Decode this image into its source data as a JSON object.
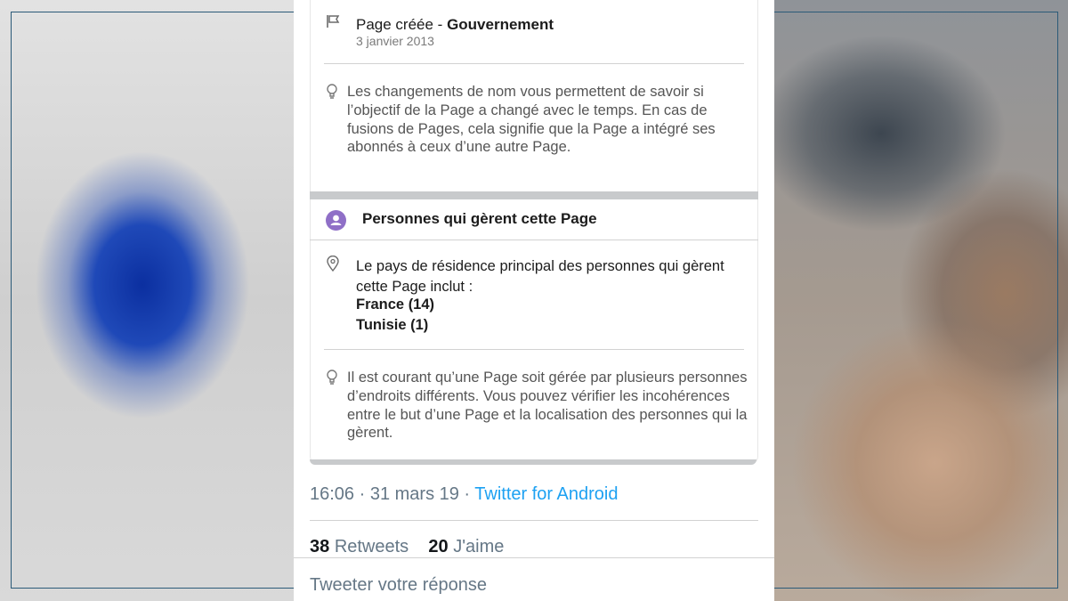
{
  "history": {
    "title_prefix": "Page créée - ",
    "title_bold": "Gouvernement",
    "date": "3 janvier 2013"
  },
  "tip_name_change": "Les changements de nom vous permettent de savoir si l’objectif de la Page a changé avec le temps. En cas de fusions de Pages, cela signifie que la Page a intégré ses abonnés à ceux d’une autre Page.",
  "managers": {
    "heading": "Personnes qui gèrent cette Page",
    "residence_text": "Le pays de résidence principal des personnes qui gèrent cette Page inclut :",
    "countries": [
      "France (14)",
      "Tunisie (1)"
    ]
  },
  "tip_managers": "Il est courant qu’une Page soit gérée par plusieurs personnes d’endroits différents. Vous pouvez vérifier les incohérences entre le but d’une Page et la localisation des personnes qui la gèrent.",
  "tweet": {
    "time": "16:06 · 31 mars 19 · ",
    "source": "Twitter for Android",
    "retweets_count": "38",
    "retweets_label": "Retweets",
    "likes_count": "20",
    "likes_label": "J'aime",
    "reply_placeholder": "Tweeter votre réponse"
  },
  "colors": {
    "link": "#1da1f2",
    "muted": "#657786",
    "badge": "#8f6fc7"
  }
}
